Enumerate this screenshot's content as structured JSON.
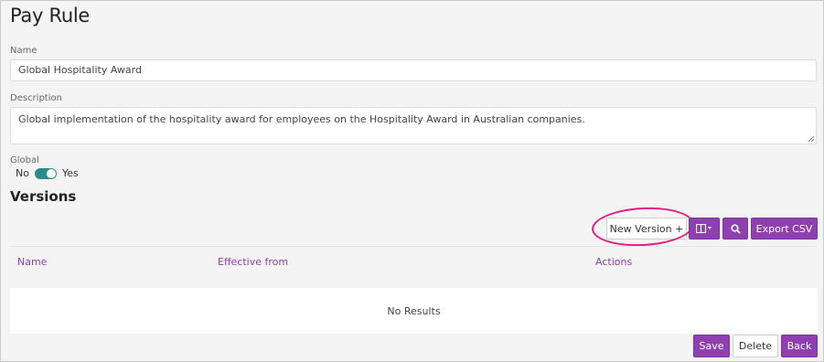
{
  "page": {
    "title": "Pay Rule"
  },
  "form": {
    "name_label": "Name",
    "name_value": "Global Hospitality Award",
    "description_label": "Description",
    "description_value": "Global implementation of the hospitality award for employees on the Hospitality Award in Australian companies.",
    "global_label": "Global",
    "toggle_off_label": "No",
    "toggle_on_label": "Yes",
    "global_value": true
  },
  "versions": {
    "title": "Versions",
    "new_version_label": "New Version +",
    "columns_icon": "columns-icon",
    "search_icon": "search-icon",
    "export_label": "Export CSV",
    "columns": [
      "Name",
      "Effective from",
      "Actions"
    ],
    "empty_text": "No Results"
  },
  "footer": {
    "save_label": "Save",
    "delete_label": "Delete",
    "back_label": "Back"
  },
  "colors": {
    "accent": "#8e3fb0",
    "toggle": "#2a8c8a",
    "highlight": "#e21c86"
  }
}
